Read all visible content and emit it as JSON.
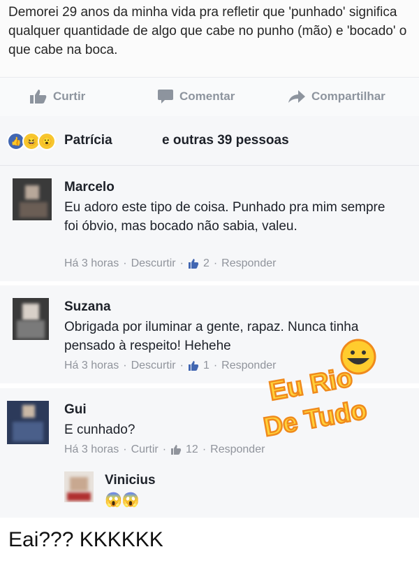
{
  "post": {
    "text": "Demorei 29 anos da minha vida pra refletir que 'punhado' significa qualquer quantidade de algo que cabe no punho (mão) e 'bocado' o que cabe na boca."
  },
  "actions": {
    "like_label": "Curtir",
    "comment_label": "Comentar",
    "share_label": "Compartilhar"
  },
  "reactions": {
    "name": "Patrícia",
    "others": "e outras 39 pessoas"
  },
  "comments": [
    {
      "name": "Marcelo",
      "text": "Eu adoro este tipo de coisa. Punhado pra mim sempre foi óbvio, mas bocado não sabia, valeu.",
      "time": "Há 3 horas",
      "action": "Descurtir",
      "likes": "2",
      "reply": "Responder"
    },
    {
      "name": "Suzana",
      "text": "Obrigada por iluminar a gente, rapaz. Nunca tinha pensado à respeito! Hehehe",
      "time": "Há 3 horas",
      "action": "Descurtir",
      "likes": "1",
      "reply": "Responder"
    },
    {
      "name": "Gui",
      "text": "E cunhado?",
      "time": "Há 3 horas",
      "action": "Curtir",
      "likes": "12",
      "reply": "Responder"
    }
  ],
  "reply": {
    "name": "Vinicius",
    "text": "😱😱"
  },
  "watermark": {
    "line1": "Eu Rio",
    "line2": "De Tudo"
  },
  "caption": "Eai??? KKKKKK",
  "colors": {
    "accent": "#4267b2",
    "muted": "#90949c",
    "logo_yellow": "#ffd23a",
    "logo_orange": "#f08a1c"
  }
}
